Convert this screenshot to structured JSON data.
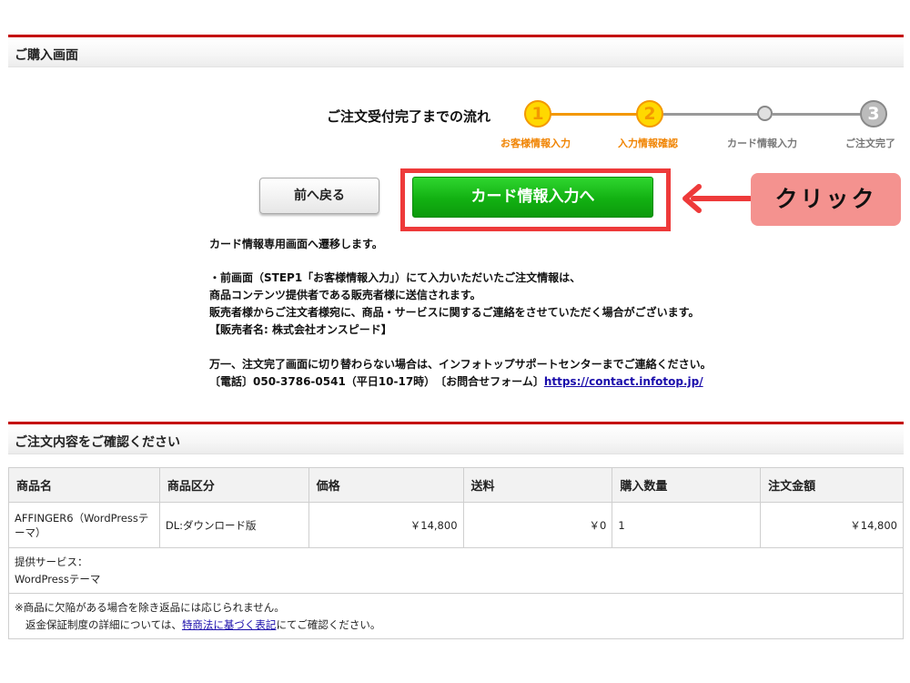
{
  "purchase_header": {
    "title": "ご購入画面"
  },
  "flow": {
    "title": "ご注文受付完了までの流れ",
    "steps": [
      {
        "number": "1",
        "label": "お客様情報入力"
      },
      {
        "number": "2",
        "label": "入力情報確認"
      },
      {
        "number": "",
        "label": "カード情報入力"
      },
      {
        "number": "3",
        "label": "ご注文完了"
      }
    ]
  },
  "buttons": {
    "back_label": "前へ戻る",
    "card_label": "カード情報入力へ"
  },
  "annotation": {
    "click_label": "クリック",
    "arrow_color": "#ee3a3a"
  },
  "info": {
    "line1": "カード情報専用画面へ遷移します。",
    "line2": "・前画面（STEP1「お客様情報入力」）にて入力いただいたご注文情報は、",
    "line3": "商品コンテンツ提供者である販売者様に送信されます。",
    "line4": "販売者様からご注文者様宛に、商品・サービスに関するご連絡をさせていただく場合がございます。",
    "line5": "【販売者名: 株式会社オンスピード】",
    "line6": "万一、注文完了画面に切り替わらない場合は、インフォトップサポートセンターまでご連絡ください。",
    "line7_prefix": "〔電話〕050-3786-0541（平日10-17時）　〔お問合せフォーム〕",
    "contact_link": "https://contact.infotop.jp/"
  },
  "order_header": {
    "title": "ご注文内容をご確認ください"
  },
  "table": {
    "columns": [
      "商品名",
      "商品区分",
      "価格",
      "送料",
      "購入数量",
      "注文金額"
    ],
    "row": {
      "name": "AFFINGER6（WordPressテーマ）",
      "category": "DL:ダウンロード版",
      "price": "￥14,800",
      "shipping": "￥0",
      "quantity": "1",
      "total": "￥14,800"
    },
    "service_label": "提供サービス：",
    "service_value": "WordPressテーマ",
    "note_line1": "※商品に欠陥がある場合を除き返品には応じられません。",
    "note_line2_prefix": "返金保証制度の詳細については、",
    "note_link": "特商法に基づく表記",
    "note_line2_suffix": "にてご確認ください。"
  },
  "colors": {
    "header_border": "#c40000",
    "step_active": "#f39800",
    "step_active_fill": "#ffd800",
    "button_green": "#12b112",
    "highlight_red": "#ee3a3a",
    "badge_pink": "#f4928f"
  }
}
